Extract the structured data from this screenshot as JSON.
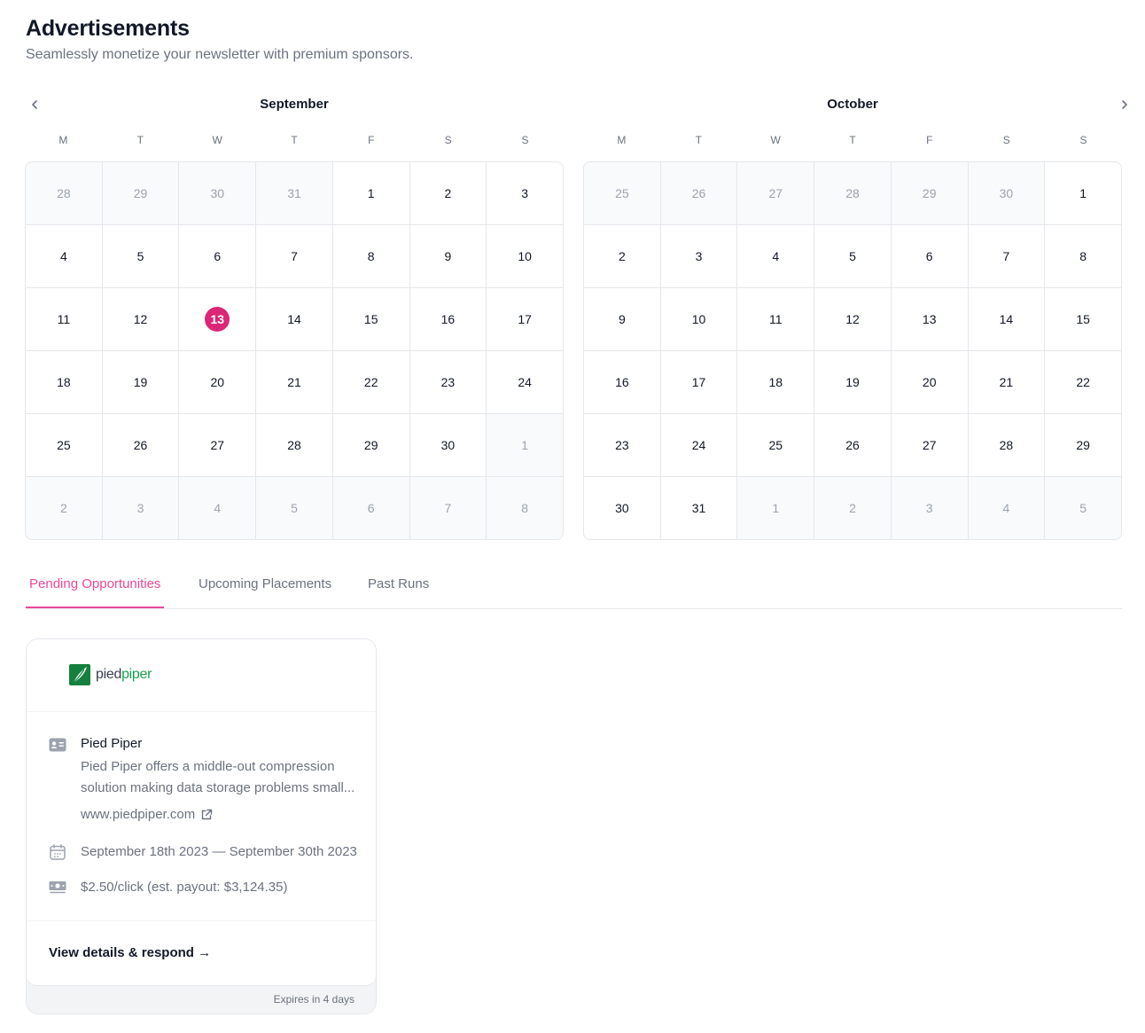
{
  "header": {
    "title": "Advertisements",
    "subtitle": "Seamlessly monetize your newsletter with premium sponsors."
  },
  "calendars": [
    {
      "month": "September",
      "weekdays": [
        "M",
        "T",
        "W",
        "T",
        "F",
        "S",
        "S"
      ],
      "days": [
        {
          "d": "28",
          "out": true
        },
        {
          "d": "29",
          "out": true
        },
        {
          "d": "30",
          "out": true
        },
        {
          "d": "31",
          "out": true
        },
        {
          "d": "1"
        },
        {
          "d": "2"
        },
        {
          "d": "3"
        },
        {
          "d": "4"
        },
        {
          "d": "5"
        },
        {
          "d": "6"
        },
        {
          "d": "7"
        },
        {
          "d": "8"
        },
        {
          "d": "9"
        },
        {
          "d": "10"
        },
        {
          "d": "11"
        },
        {
          "d": "12"
        },
        {
          "d": "13",
          "today": true
        },
        {
          "d": "14"
        },
        {
          "d": "15"
        },
        {
          "d": "16"
        },
        {
          "d": "17"
        },
        {
          "d": "18"
        },
        {
          "d": "19"
        },
        {
          "d": "20"
        },
        {
          "d": "21"
        },
        {
          "d": "22"
        },
        {
          "d": "23"
        },
        {
          "d": "24"
        },
        {
          "d": "25"
        },
        {
          "d": "26"
        },
        {
          "d": "27"
        },
        {
          "d": "28"
        },
        {
          "d": "29"
        },
        {
          "d": "30"
        },
        {
          "d": "1",
          "out": true
        },
        {
          "d": "2",
          "out": true
        },
        {
          "d": "3",
          "out": true
        },
        {
          "d": "4",
          "out": true
        },
        {
          "d": "5",
          "out": true
        },
        {
          "d": "6",
          "out": true
        },
        {
          "d": "7",
          "out": true
        },
        {
          "d": "8",
          "out": true
        }
      ]
    },
    {
      "month": "October",
      "weekdays": [
        "M",
        "T",
        "W",
        "T",
        "F",
        "S",
        "S"
      ],
      "days": [
        {
          "d": "25",
          "out": true
        },
        {
          "d": "26",
          "out": true
        },
        {
          "d": "27",
          "out": true
        },
        {
          "d": "28",
          "out": true
        },
        {
          "d": "29",
          "out": true
        },
        {
          "d": "30",
          "out": true
        },
        {
          "d": "1"
        },
        {
          "d": "2"
        },
        {
          "d": "3"
        },
        {
          "d": "4"
        },
        {
          "d": "5"
        },
        {
          "d": "6"
        },
        {
          "d": "7"
        },
        {
          "d": "8"
        },
        {
          "d": "9"
        },
        {
          "d": "10"
        },
        {
          "d": "11"
        },
        {
          "d": "12"
        },
        {
          "d": "13"
        },
        {
          "d": "14"
        },
        {
          "d": "15"
        },
        {
          "d": "16"
        },
        {
          "d": "17"
        },
        {
          "d": "18"
        },
        {
          "d": "19"
        },
        {
          "d": "20"
        },
        {
          "d": "21"
        },
        {
          "d": "22"
        },
        {
          "d": "23"
        },
        {
          "d": "24"
        },
        {
          "d": "25"
        },
        {
          "d": "26"
        },
        {
          "d": "27"
        },
        {
          "d": "28"
        },
        {
          "d": "29"
        },
        {
          "d": "30"
        },
        {
          "d": "31"
        },
        {
          "d": "1",
          "out": true
        },
        {
          "d": "2",
          "out": true
        },
        {
          "d": "3",
          "out": true
        },
        {
          "d": "4",
          "out": true
        },
        {
          "d": "5",
          "out": true
        }
      ]
    }
  ],
  "icons": {
    "prev": "chevron-left-icon",
    "next": "chevron-right-icon"
  },
  "tabs": [
    {
      "label": "Pending Opportunities",
      "active": true
    },
    {
      "label": "Upcoming Placements",
      "active": false
    },
    {
      "label": "Past Runs",
      "active": false
    }
  ],
  "opportunity": {
    "logo_part1": "pied",
    "logo_part2": "piper",
    "company": "Pied Piper",
    "description": "Pied Piper offers a middle-out compression solution making data storage problems small...",
    "website": "www.piedpiper.com",
    "dates": "September 18th 2023 — September 30th 2023",
    "rate": "$2.50/click (est. payout: $3,124.35)",
    "cta": "View details & respond →",
    "expires": "Expires in 4 days"
  },
  "colors": {
    "accent": "#ec4899",
    "today": "#db2777",
    "logo_green": "#16a34a"
  }
}
